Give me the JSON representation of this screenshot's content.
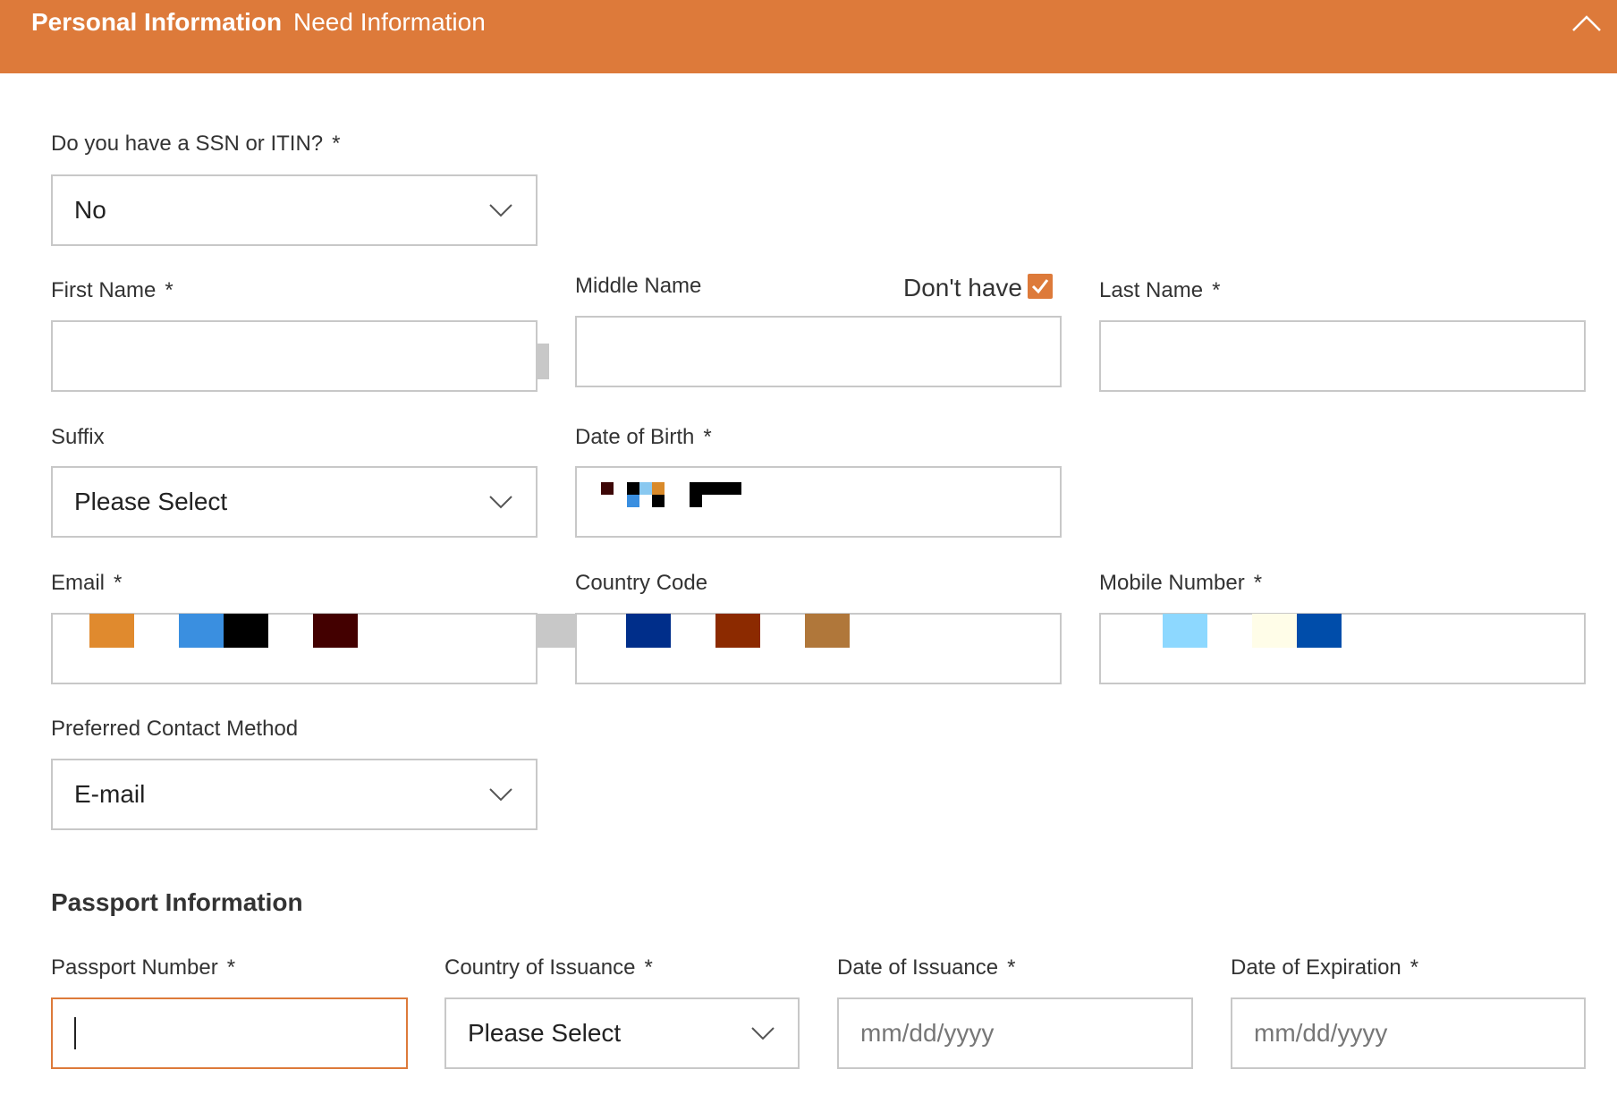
{
  "header": {
    "title": "Personal Information",
    "subtitle": "Need Information",
    "collapse_icon": "chevron-up-icon",
    "background": "#dd7a3a"
  },
  "ssn": {
    "label": "Do you have a SSN or ITIN?",
    "required": "*",
    "value": "No"
  },
  "first_name": {
    "label": "First Name",
    "required": "*",
    "value": ""
  },
  "middle_name": {
    "label": "Middle Name",
    "dont_have_label": "Don't have",
    "dont_have_checked": true,
    "value": ""
  },
  "last_name": {
    "label": "Last Name",
    "required": "*",
    "value": ""
  },
  "suffix": {
    "label": "Suffix",
    "value": "Please Select"
  },
  "dob": {
    "label": "Date of Birth",
    "required": "*"
  },
  "email": {
    "label": "Email",
    "required": "*"
  },
  "country_code": {
    "label": "Country Code"
  },
  "mobile": {
    "label": "Mobile Number",
    "required": "*"
  },
  "contact_method": {
    "label": "Preferred Contact Method",
    "value": "E-mail"
  },
  "passport": {
    "section_title": "Passport Information",
    "number": {
      "label": "Passport Number",
      "required": "*",
      "value": ""
    },
    "country": {
      "label": "Country of Issuance",
      "required": "*",
      "value": "Please Select"
    },
    "issue_date": {
      "label": "Date of Issuance",
      "required": "*",
      "placeholder": "mm/dd/yyyy"
    },
    "expiry_date": {
      "label": "Date of Expiration",
      "required": "*",
      "placeholder": "mm/dd/yyyy"
    }
  },
  "colors": {
    "accent": "#dd7a3a",
    "border": "#c8c8c8",
    "focus_border": "#dd7a3a"
  }
}
